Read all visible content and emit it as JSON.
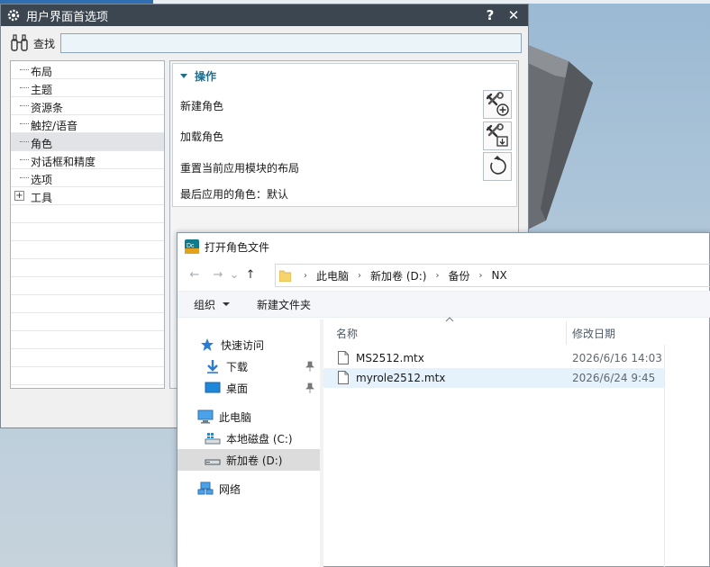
{
  "preferences": {
    "title": "用户界面首选项",
    "help_label": "?",
    "close_label": "✕",
    "find": {
      "label": "查找",
      "value": ""
    },
    "tree": [
      {
        "label": "布局"
      },
      {
        "label": "主题"
      },
      {
        "label": "资源条"
      },
      {
        "label": "触控/语音"
      },
      {
        "label": "角色",
        "selected": true
      },
      {
        "label": "对话框和精度"
      },
      {
        "label": "选项"
      },
      {
        "label": "工具",
        "expandable": true
      }
    ],
    "tree_expander": "+",
    "group": {
      "title": "操作",
      "new_role": "新建角色",
      "load_role": "加载角色",
      "reset_layout": "重置当前应用模块的布局",
      "last_role": "最后应用的角色：默认"
    }
  },
  "file_dialog": {
    "title": "打开角色文件",
    "nav": {
      "back": "←",
      "forward": "→",
      "recent": "⌄",
      "up": "↑"
    },
    "path": [
      "此电脑",
      "新加卷 (D:)",
      "备份",
      "NX"
    ],
    "path_separator": "›",
    "toolbar": {
      "organize": "组织",
      "new_folder": "新建文件夹"
    },
    "sidebar": {
      "quick_access": "快速访问",
      "downloads": "下载",
      "desktop": "桌面",
      "this_pc": "此电脑",
      "local_disk": "本地磁盘 (C:)",
      "new_volume": "新加卷 (D:)",
      "network": "网络"
    },
    "columns": {
      "name": "名称",
      "modified": "修改日期"
    },
    "files": [
      {
        "name": "MS2512.mtx",
        "modified": "2026/6/16 14:03"
      },
      {
        "name": "myrole2512.mtx",
        "modified": "2026/6/24 9:45",
        "highlighted": true
      }
    ]
  },
  "colors": {
    "pref_titlebar": "#3c4650",
    "group_header": "#1f6f8c",
    "selection": "#e1e3e6",
    "file_highlight": "#e5f1fb"
  }
}
